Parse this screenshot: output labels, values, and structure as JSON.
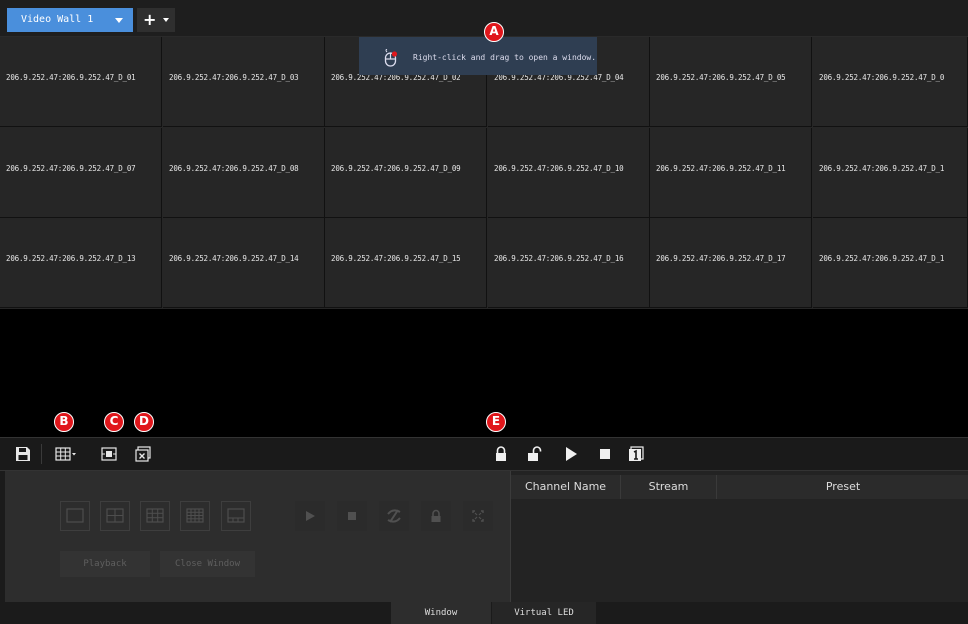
{
  "tabs": {
    "active_label": "Video Wall 1"
  },
  "hint": {
    "text": "Right-click and drag to open a window."
  },
  "markers": {
    "a": "A",
    "b": "B",
    "c": "C",
    "d": "D",
    "e": "E"
  },
  "wall": {
    "rows": [
      [
        "206.9.252.47:206.9.252.47_D_01",
        "206.9.252.47:206.9.252.47_D_03",
        "206.9.252.47:206.9.252.47_D_02",
        "206.9.252.47:206.9.252.47_D_04",
        "206.9.252.47:206.9.252.47_D_05",
        "206.9.252.47:206.9.252.47_D_0"
      ],
      [
        "206.9.252.47:206.9.252.47_D_07",
        "206.9.252.47:206.9.252.47_D_08",
        "206.9.252.47:206.9.252.47_D_09",
        "206.9.252.47:206.9.252.47_D_10",
        "206.9.252.47:206.9.252.47_D_11",
        "206.9.252.47:206.9.252.47_D_1"
      ],
      [
        "206.9.252.47:206.9.252.47_D_13",
        "206.9.252.47:206.9.252.47_D_14",
        "206.9.252.47:206.9.252.47_D_15",
        "206.9.252.47:206.9.252.47_D_16",
        "206.9.252.47:206.9.252.47_D_17",
        "206.9.252.47:206.9.252.47_D_1"
      ]
    ]
  },
  "panel": {
    "playback_label": "Playback",
    "close_window_label": "Close Window"
  },
  "table": {
    "columns": [
      "Channel Name",
      "Stream",
      "Preset"
    ]
  },
  "bottom_tabs": {
    "window": "Window",
    "virtual_led": "Virtual LED"
  },
  "colors": {
    "accent": "#4a8fdc",
    "marker": "#e0161b",
    "hint_bg": "#2f3e52"
  }
}
